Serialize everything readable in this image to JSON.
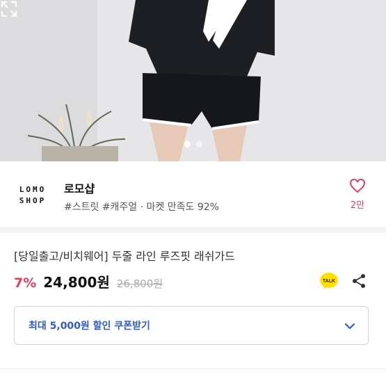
{
  "shop": {
    "logo_line1": "LOMO",
    "logo_line2": "SHOP",
    "name": "로모샵",
    "meta": "#스트릿 #캐주얼 · 마켓 만족도 92%",
    "like_count": "2만"
  },
  "product": {
    "title": "[당일출고/비치웨어] 두줄 라인 루즈핏 래쉬가드",
    "discount": "7%",
    "price": "24,800원",
    "original_price": "26,800원",
    "talk_label": "TALK"
  },
  "coupon": {
    "label": "최대 5,000원 할인 쿠폰받기"
  },
  "gallery": {
    "slide_count": 2,
    "active_slide": 1
  },
  "colors": {
    "accent_red": "#ef3b5c",
    "coupon_blue": "#2c5ad8",
    "kakao_yellow": "#ffe100"
  },
  "icons": [
    "expand-icon",
    "heart-icon",
    "kakaotalk-icon",
    "share-icon",
    "chevron-down-icon"
  ]
}
